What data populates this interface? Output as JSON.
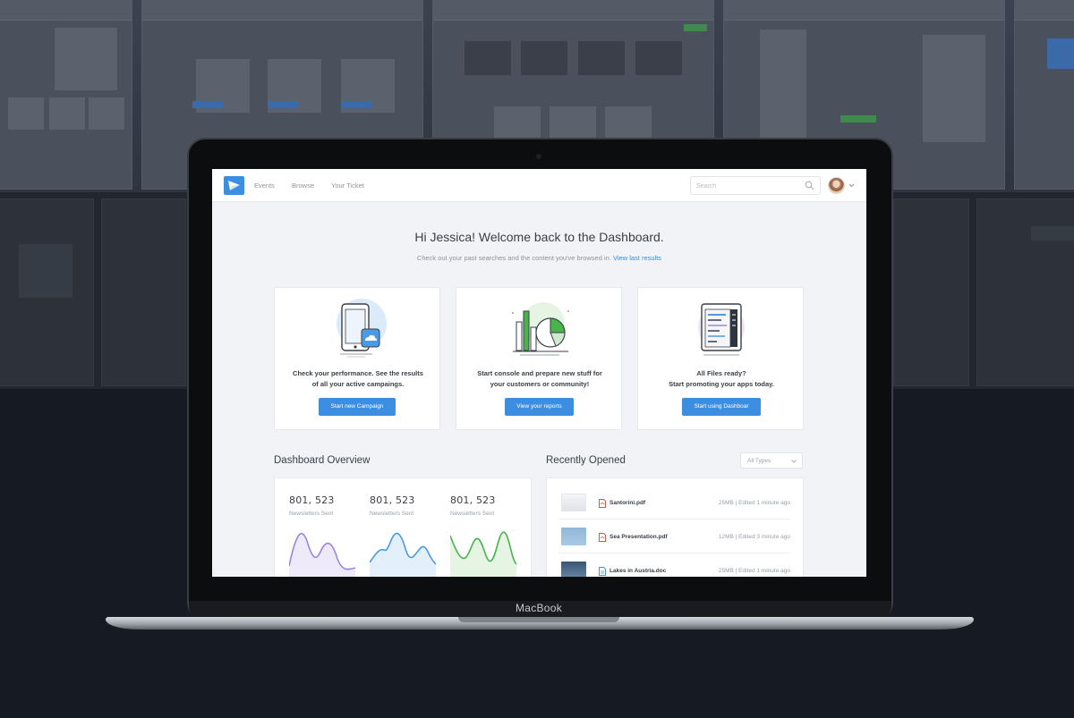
{
  "device_label": "MacBook",
  "nav": {
    "items": [
      "Events",
      "Browse",
      "Your Ticket"
    ]
  },
  "search": {
    "placeholder": "Search"
  },
  "welcome": {
    "title": "Hi Jessica! Welcome back to the Dashboard.",
    "subtitle": "Check out your past searches and the content you've browsed in.",
    "link": "View last results"
  },
  "cards": [
    {
      "text_line1": "Check your performance. See the results",
      "text_line2": "of all your active campaings.",
      "button": "Start new Campaign",
      "icon": "phone-cloud-illustration"
    },
    {
      "text_line1": "Start console and prepare new stuff for",
      "text_line2": "your customers or community!",
      "button": "View your reports",
      "icon": "bar-pie-chart-illustration"
    },
    {
      "text_line1": "All Files ready?",
      "text_line2": "Start promoting your apps today.",
      "button": "Start using Dashboar",
      "icon": "tablet-code-illustration"
    }
  ],
  "overview": {
    "title": "Dashboard Overview",
    "stats": [
      {
        "value": "801, 523",
        "label": "Newsletters Sent",
        "color": "#9b86d8"
      },
      {
        "value": "801, 523",
        "label": "Newsletters Sent",
        "color": "#4a9be6"
      },
      {
        "value": "801, 523",
        "label": "Newsletters Sent",
        "color": "#48b44a"
      }
    ]
  },
  "recent": {
    "title": "Recently Opened",
    "filter": "All Types",
    "files": [
      {
        "name": "Santorini.pdf",
        "meta": "25MB  |  Edited 1 minute ago",
        "type": "pdf"
      },
      {
        "name": "Sea Presentation.pdf",
        "meta": "12MB  |  Edited 3 minute ago",
        "type": "pdf"
      },
      {
        "name": "Lakes in Austria.doc",
        "meta": "25MB  |  Edited 1 minute ago",
        "type": "doc"
      }
    ]
  },
  "colors": {
    "accent": "#3d8ee0",
    "pdf_icon": "#e4534b",
    "doc_icon": "#4a8fe0"
  }
}
